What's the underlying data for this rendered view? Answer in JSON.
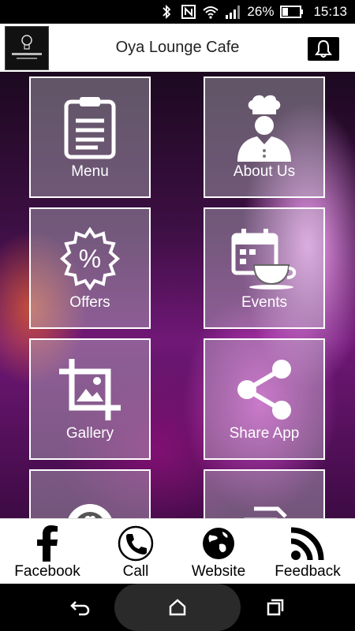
{
  "status_bar": {
    "battery_percent": "26%",
    "time": "15:13",
    "icons": [
      "bluetooth-icon",
      "nfc-icon",
      "wifi-icon",
      "signal-icon",
      "battery-icon"
    ]
  },
  "header": {
    "title": "Oya Lounge Cafe",
    "logo_icon": "oya-lounge-logo",
    "bell_icon": "bell-icon"
  },
  "tiles": [
    {
      "label": "Menu",
      "icon": "clipboard-icon"
    },
    {
      "label": "About Us",
      "icon": "chef-icon"
    },
    {
      "label": "Offers",
      "icon": "percent-badge-icon"
    },
    {
      "label": "Events",
      "icon": "calendar-cup-icon"
    },
    {
      "label": "Gallery",
      "icon": "crop-image-icon"
    },
    {
      "label": "Share App",
      "icon": "share-icon"
    },
    {
      "label": "",
      "icon": "chef-badge-icon"
    },
    {
      "label": "",
      "icon": "document-icon"
    }
  ],
  "bottom_bar": [
    {
      "label": "Facebook",
      "icon": "facebook-icon"
    },
    {
      "label": "Call",
      "icon": "phone-icon"
    },
    {
      "label": "Website",
      "icon": "globe-icon"
    },
    {
      "label": "Feedback",
      "icon": "rss-icon"
    }
  ],
  "nav": {
    "back_icon": "back-icon",
    "home_icon": "home-icon",
    "recents_icon": "recents-icon"
  },
  "colors": {
    "header_bg": "#ffffff",
    "tile_border": "#ffffff",
    "accent_magenta": "#c040c0"
  }
}
